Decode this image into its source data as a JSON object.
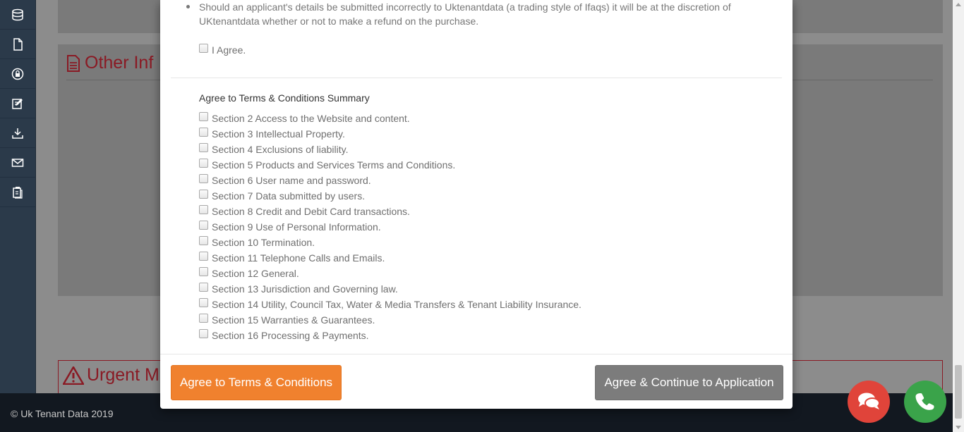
{
  "sidebar": {
    "icons": [
      "database-icon",
      "file-icon",
      "lock-circle-icon",
      "edit-icon",
      "download-icon",
      "mail-icon",
      "clipboard-icon"
    ]
  },
  "background": {
    "other_title": "Other Inf",
    "urgent_title": "Urgent M",
    "footer_text": "© Uk Tenant Data 2019"
  },
  "modal": {
    "bullet_text": "Should an applicant's details be submitted incorrectly to Uktenantdata (a trading style of Ifaqs) it will be at the discretion of UKtenantdata whether or not to make a refund on the purchase.",
    "agree_label": "I Agree.",
    "summary_title": "Agree to Terms & Conditions Summary",
    "sections": [
      "Section 2 Access to the Website and content.",
      "Section 3 Intellectual Property.",
      "Section 4 Exclusions of liability.",
      "Section 5 Products and Services Terms and Conditions.",
      "Section 6 User name and password.",
      "Section 7 Data submitted by users.",
      "Section 8 Credit and Debit Card transactions.",
      "Section 9 Use of Personal Information.",
      "Section 10 Termination.",
      "Section 11 Telephone Calls and Emails.",
      "Section 12 General.",
      "Section 13 Jurisdiction and Governing law.",
      "Section 14 Utility, Council Tax, Water & Media Transfers & Tenant Liability Insurance.",
      "Section 15 Warranties & Guarantees.",
      "Section 16 Processing & Payments."
    ],
    "agree_terms_button": "Agree to Terms & Conditions",
    "continue_button": "Agree & Continue to Application"
  },
  "colors": {
    "orange": "#f0812e",
    "gray_button": "#7c7c7c",
    "chat_red": "#e0443a",
    "call_green": "#3aa34a",
    "accent_red": "#8a1a24"
  }
}
